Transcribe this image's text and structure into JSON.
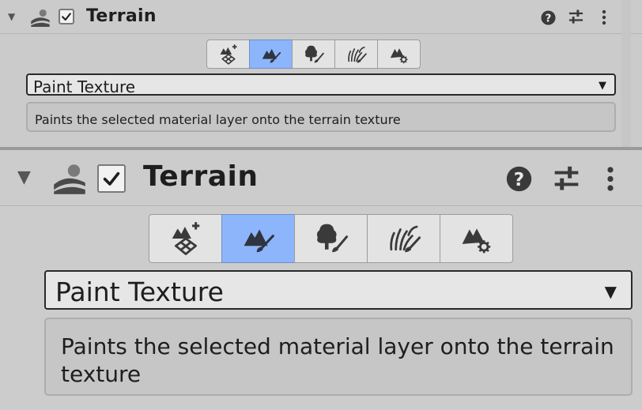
{
  "component": {
    "title": "Terrain",
    "enabled": true,
    "icons": {
      "foldout": "triangle-down-icon",
      "component": "terrain-component-icon",
      "help": "help-icon",
      "presets": "presets-sliders-icon",
      "menu": "kebab-menu-icon"
    }
  },
  "toolbar": {
    "tools": [
      {
        "name": "create-neighbor-terrains-icon",
        "active": false
      },
      {
        "name": "paint-terrain-icon",
        "active": true
      },
      {
        "name": "paint-trees-icon",
        "active": false
      },
      {
        "name": "paint-details-icon",
        "active": false
      },
      {
        "name": "terrain-settings-icon",
        "active": false
      }
    ]
  },
  "paint_mode": {
    "selected": "Paint Texture",
    "description": "Paints the selected material layer onto the terrain texture"
  },
  "colors": {
    "active_tool": "#8cb5fb",
    "panel_bg": "#cbcbcb"
  }
}
